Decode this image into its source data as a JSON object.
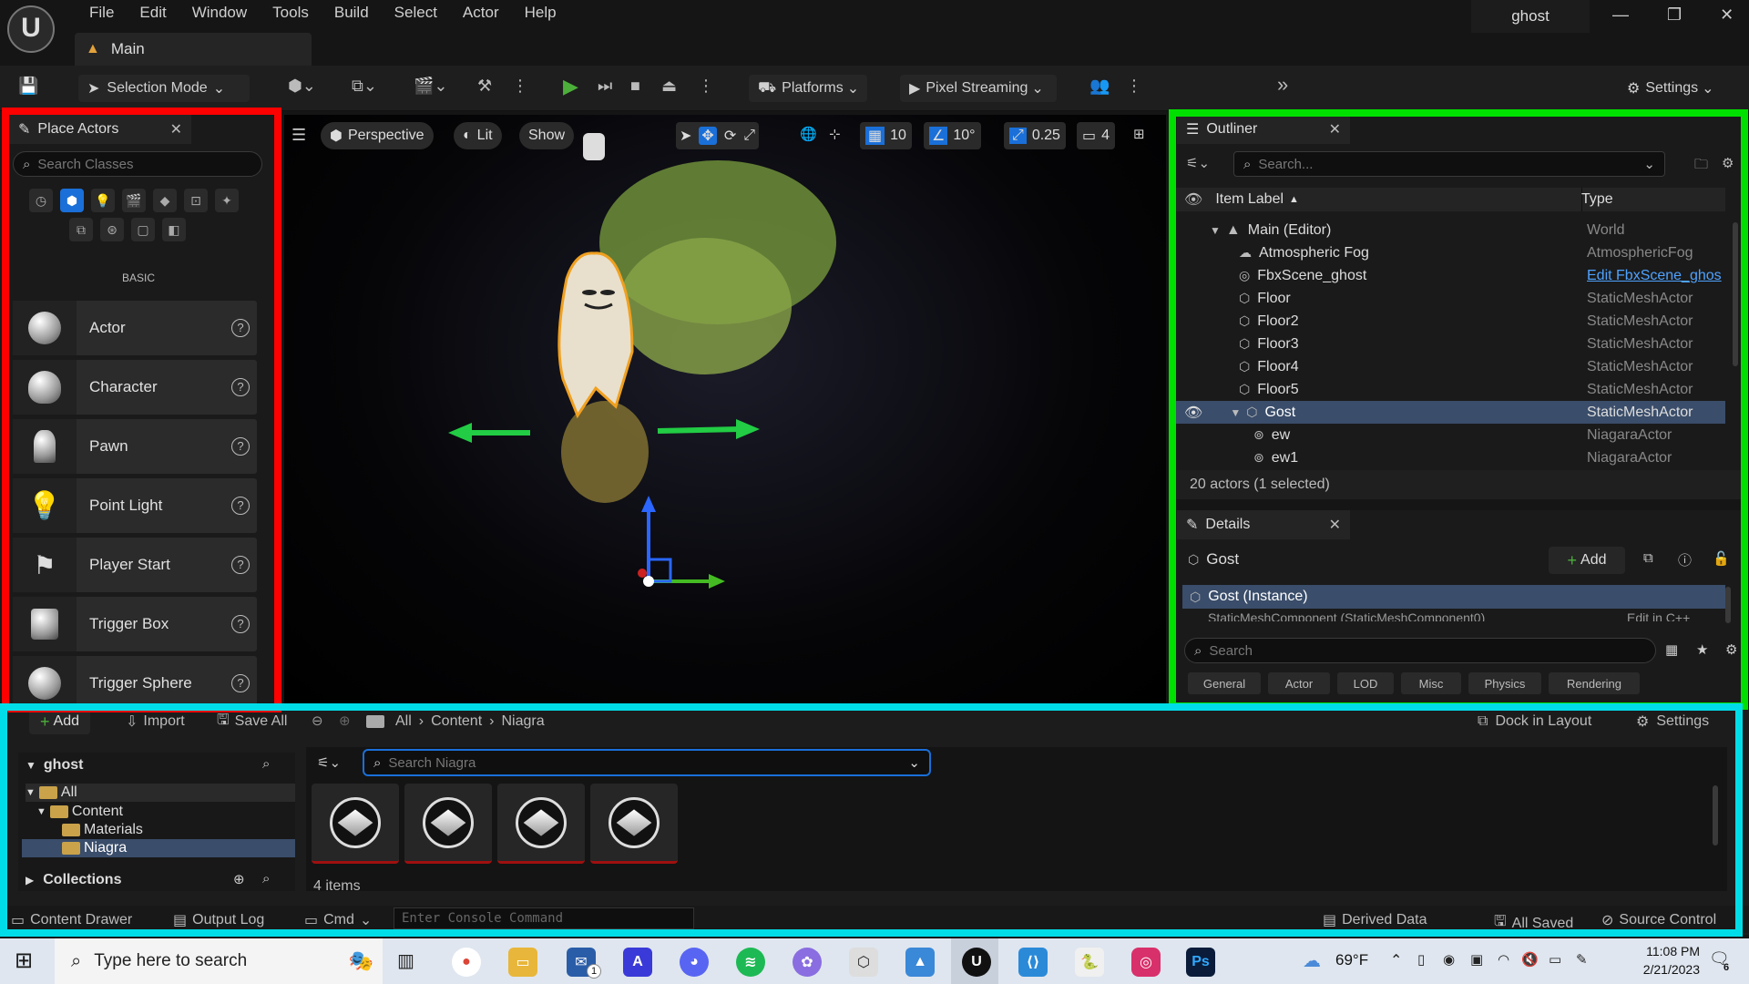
{
  "titlebar": {
    "menu": [
      "File",
      "Edit",
      "Window",
      "Tools",
      "Build",
      "Select",
      "Actor",
      "Help"
    ],
    "project_name": "ghost",
    "doc_tab": "Main",
    "window_controls": [
      "—",
      "❐",
      "✕"
    ]
  },
  "toolbar": {
    "selection_mode": "Selection Mode",
    "platforms": "Platforms",
    "pixel_streaming": "Pixel Streaming",
    "settings": "Settings"
  },
  "place_actors": {
    "tab_label": "Place Actors",
    "search_placeholder": "Search Classes",
    "category_label": "BASIC",
    "items": [
      {
        "label": "Actor"
      },
      {
        "label": "Character"
      },
      {
        "label": "Pawn"
      },
      {
        "label": "Point Light"
      },
      {
        "label": "Player Start"
      },
      {
        "label": "Trigger Box"
      },
      {
        "label": "Trigger Sphere"
      }
    ]
  },
  "viewport": {
    "perspective": "Perspective",
    "lit": "Lit",
    "show": "Show",
    "grid_snap": "10",
    "rot_snap": "10°",
    "scale_snap": "0.25",
    "camera_speed": "4"
  },
  "outliner": {
    "tab_label": "Outliner",
    "search_placeholder": "Search...",
    "col_label": "Item Label",
    "col_type": "Type",
    "rows": [
      {
        "label": "Main (Editor)",
        "type": "World"
      },
      {
        "label": "Atmospheric Fog",
        "type": "AtmosphericFog"
      },
      {
        "label": "FbxScene_ghost",
        "type": "Edit FbxScene_ghos"
      },
      {
        "label": "Floor",
        "type": "StaticMeshActor"
      },
      {
        "label": "Floor2",
        "type": "StaticMeshActor"
      },
      {
        "label": "Floor3",
        "type": "StaticMeshActor"
      },
      {
        "label": "Floor4",
        "type": "StaticMeshActor"
      },
      {
        "label": "Floor5",
        "type": "StaticMeshActor"
      },
      {
        "label": "Gost",
        "type": "StaticMeshActor"
      },
      {
        "label": "ew",
        "type": "NiagaraActor"
      },
      {
        "label": "ew1",
        "type": "NiagaraActor"
      }
    ],
    "status": "20 actors (1 selected)"
  },
  "details": {
    "tab_label": "Details",
    "actor_name": "Gost",
    "add_label": "Add",
    "instance_label": "Gost (Instance)",
    "component_label": "StaticMeshComponent (StaticMeshComponent0)",
    "component_edit": "Edit in C++",
    "search_placeholder": "Search",
    "filters": [
      "General",
      "Actor",
      "LOD",
      "Misc",
      "Physics",
      "Rendering"
    ]
  },
  "content_browser": {
    "add": "Add",
    "import": "Import",
    "save_all": "Save All",
    "breadcrumb": [
      "All",
      "Content",
      "Niagra"
    ],
    "dock_in_layout": "Dock in Layout",
    "settings": "Settings",
    "tree_root": "ghost",
    "tree": [
      "All",
      "Content",
      "Materials",
      "Niagra"
    ],
    "collections": "Collections",
    "search_placeholder": "Search Niagra",
    "item_count": "4 items",
    "asset_count": 4
  },
  "statusbar": {
    "content_drawer": "Content Drawer",
    "output_log": "Output Log",
    "cmd": "Cmd",
    "console_placeholder": "Enter Console Command",
    "derived_data": "Derived Data",
    "all_saved": "All Saved",
    "source_control": "Source Control"
  },
  "taskbar": {
    "search_placeholder": "Type here to search",
    "temperature": "69°F",
    "time": "11:08 PM",
    "date": "2/21/2023",
    "notification_count": "6",
    "mail_badge": "1"
  },
  "colors": {
    "frame_red": "#ff0000",
    "frame_green": "#00e000",
    "frame_cyan": "#00dde8",
    "accent_blue": "#1a6fd8",
    "play_green": "#4caf3a"
  }
}
